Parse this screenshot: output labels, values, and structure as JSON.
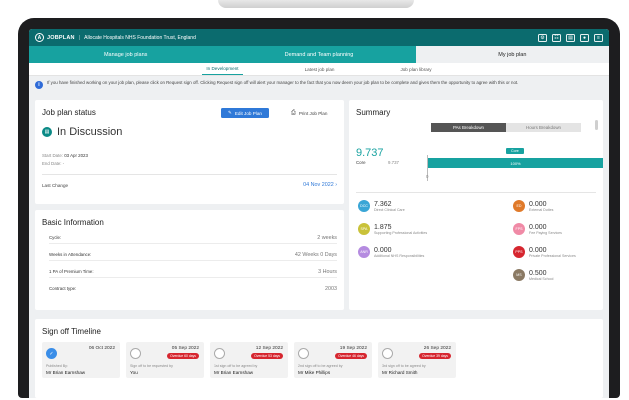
{
  "app": {
    "logo_text": "JOBPLAN",
    "org": "Allocate Hospitals NHS Foundation Trust, England"
  },
  "nav": {
    "tabs": [
      {
        "label": "Manage job plans"
      },
      {
        "label": "Demand and Team planning"
      },
      {
        "label": "My job plan"
      }
    ],
    "active_tab": "My job plan"
  },
  "subnav": {
    "tabs": [
      {
        "label": "In Development"
      },
      {
        "label": "Latest job plan"
      },
      {
        "label": "Job plan library"
      }
    ],
    "active_tab": "In Development"
  },
  "info_banner": {
    "text": "If you have finished working on your job plan, please click on Request sign off. Clicking Request sign off will alert your manager to the fact that you now deem your job plan to be complete and gives them the opportunity to agree with this or not."
  },
  "job_plan_status": {
    "title": "Job plan status",
    "edit_button": "Edit Job Plan",
    "print_button": "Print Job Plan",
    "status": "In Discussion",
    "start_date_label": "Start Date:",
    "start_date": "03 Apr 2023",
    "end_date_label": "End Date:",
    "end_date": "-",
    "last_change_label": "Last Change",
    "last_change_date": "04 Nov 2022"
  },
  "basic_information": {
    "title": "Basic Information",
    "rows": [
      {
        "label": "Cycle:",
        "value": "2 weeks"
      },
      {
        "label": "Weeks in Attendance:",
        "value": "42 Weeks 0 Days"
      },
      {
        "label": "1 PA of Premium Time:",
        "value": "3 Hours"
      },
      {
        "label": "Contract type:",
        "value": "2003"
      }
    ]
  },
  "summary": {
    "title": "Summary",
    "toggle": [
      {
        "label": "PAs Breakdown"
      },
      {
        "label": "Hours Breakdown"
      }
    ],
    "active_toggle": "PAs Breakdown",
    "total_value": "9.737",
    "core_label": "Core",
    "core_value": "9.737",
    "bar_tag": "Core",
    "bar_percent": "100%",
    "bar_fraction": 1.0,
    "axis_zero": "0",
    "metrics_left": [
      {
        "abbr": "DCC",
        "value": "7.362",
        "label": "Direct Clinical Care",
        "color": "#3aa6d6"
      },
      {
        "abbr": "SPA",
        "value": "1.875",
        "label": "Supporting Professional Activities",
        "color": "#c9c23a"
      },
      {
        "abbr": "ANR",
        "value": "0.000",
        "label": "Additional NHS Responsibilities",
        "color": "#b58be0"
      }
    ],
    "metrics_right": [
      {
        "abbr": "ED",
        "value": "0.000",
        "label": "External Duties",
        "color": "#e07a2a"
      },
      {
        "abbr": "FPS",
        "value": "0.000",
        "label": "Fee Paying Services",
        "color": "#f08aa6"
      },
      {
        "abbr": "PPS",
        "value": "0.000",
        "label": "Private Professional Services",
        "color": "#d6262f"
      },
      {
        "abbr": "MS",
        "value": "0.500",
        "label": "Medical School",
        "color": "#8b7a64"
      }
    ]
  },
  "sign_off_timeline": {
    "title": "Sign off Timeline",
    "items": [
      {
        "date": "06 Oct 2022",
        "badge": "",
        "role": "Published By:",
        "person": "Mr Brian Earnshaw",
        "done": true
      },
      {
        "date": "05 Sep 2022",
        "badge": "Overdue 60 days",
        "role": "Sign off to be requested by",
        "person": "You",
        "done": false
      },
      {
        "date": "12 Sep 2022",
        "badge": "Overdue 53 days",
        "role": "1st sign off to be agreed by",
        "person": "Mr Brian Earnshaw",
        "done": false
      },
      {
        "date": "19 Sep 2022",
        "badge": "Overdue 46 days",
        "role": "2nd sign off to be agreed by",
        "person": "Mr Mike Phillips",
        "done": false
      },
      {
        "date": "26 Sep 2022",
        "badge": "Overdue 39 days",
        "role": "3rd sign off to be agreed by",
        "person": "Mr Richard Smith",
        "done": false
      }
    ]
  },
  "icons": {
    "info": "info-icon",
    "edit": "pencil-icon",
    "print": "printer-icon",
    "status": "document-icon",
    "chevron": "chevron-right-icon",
    "check": "check-icon"
  },
  "colors": {
    "brand_dark": "#0b6b6e",
    "brand": "#17a2a0",
    "primary": "#2f79d8",
    "overdue": "#d6262f"
  }
}
